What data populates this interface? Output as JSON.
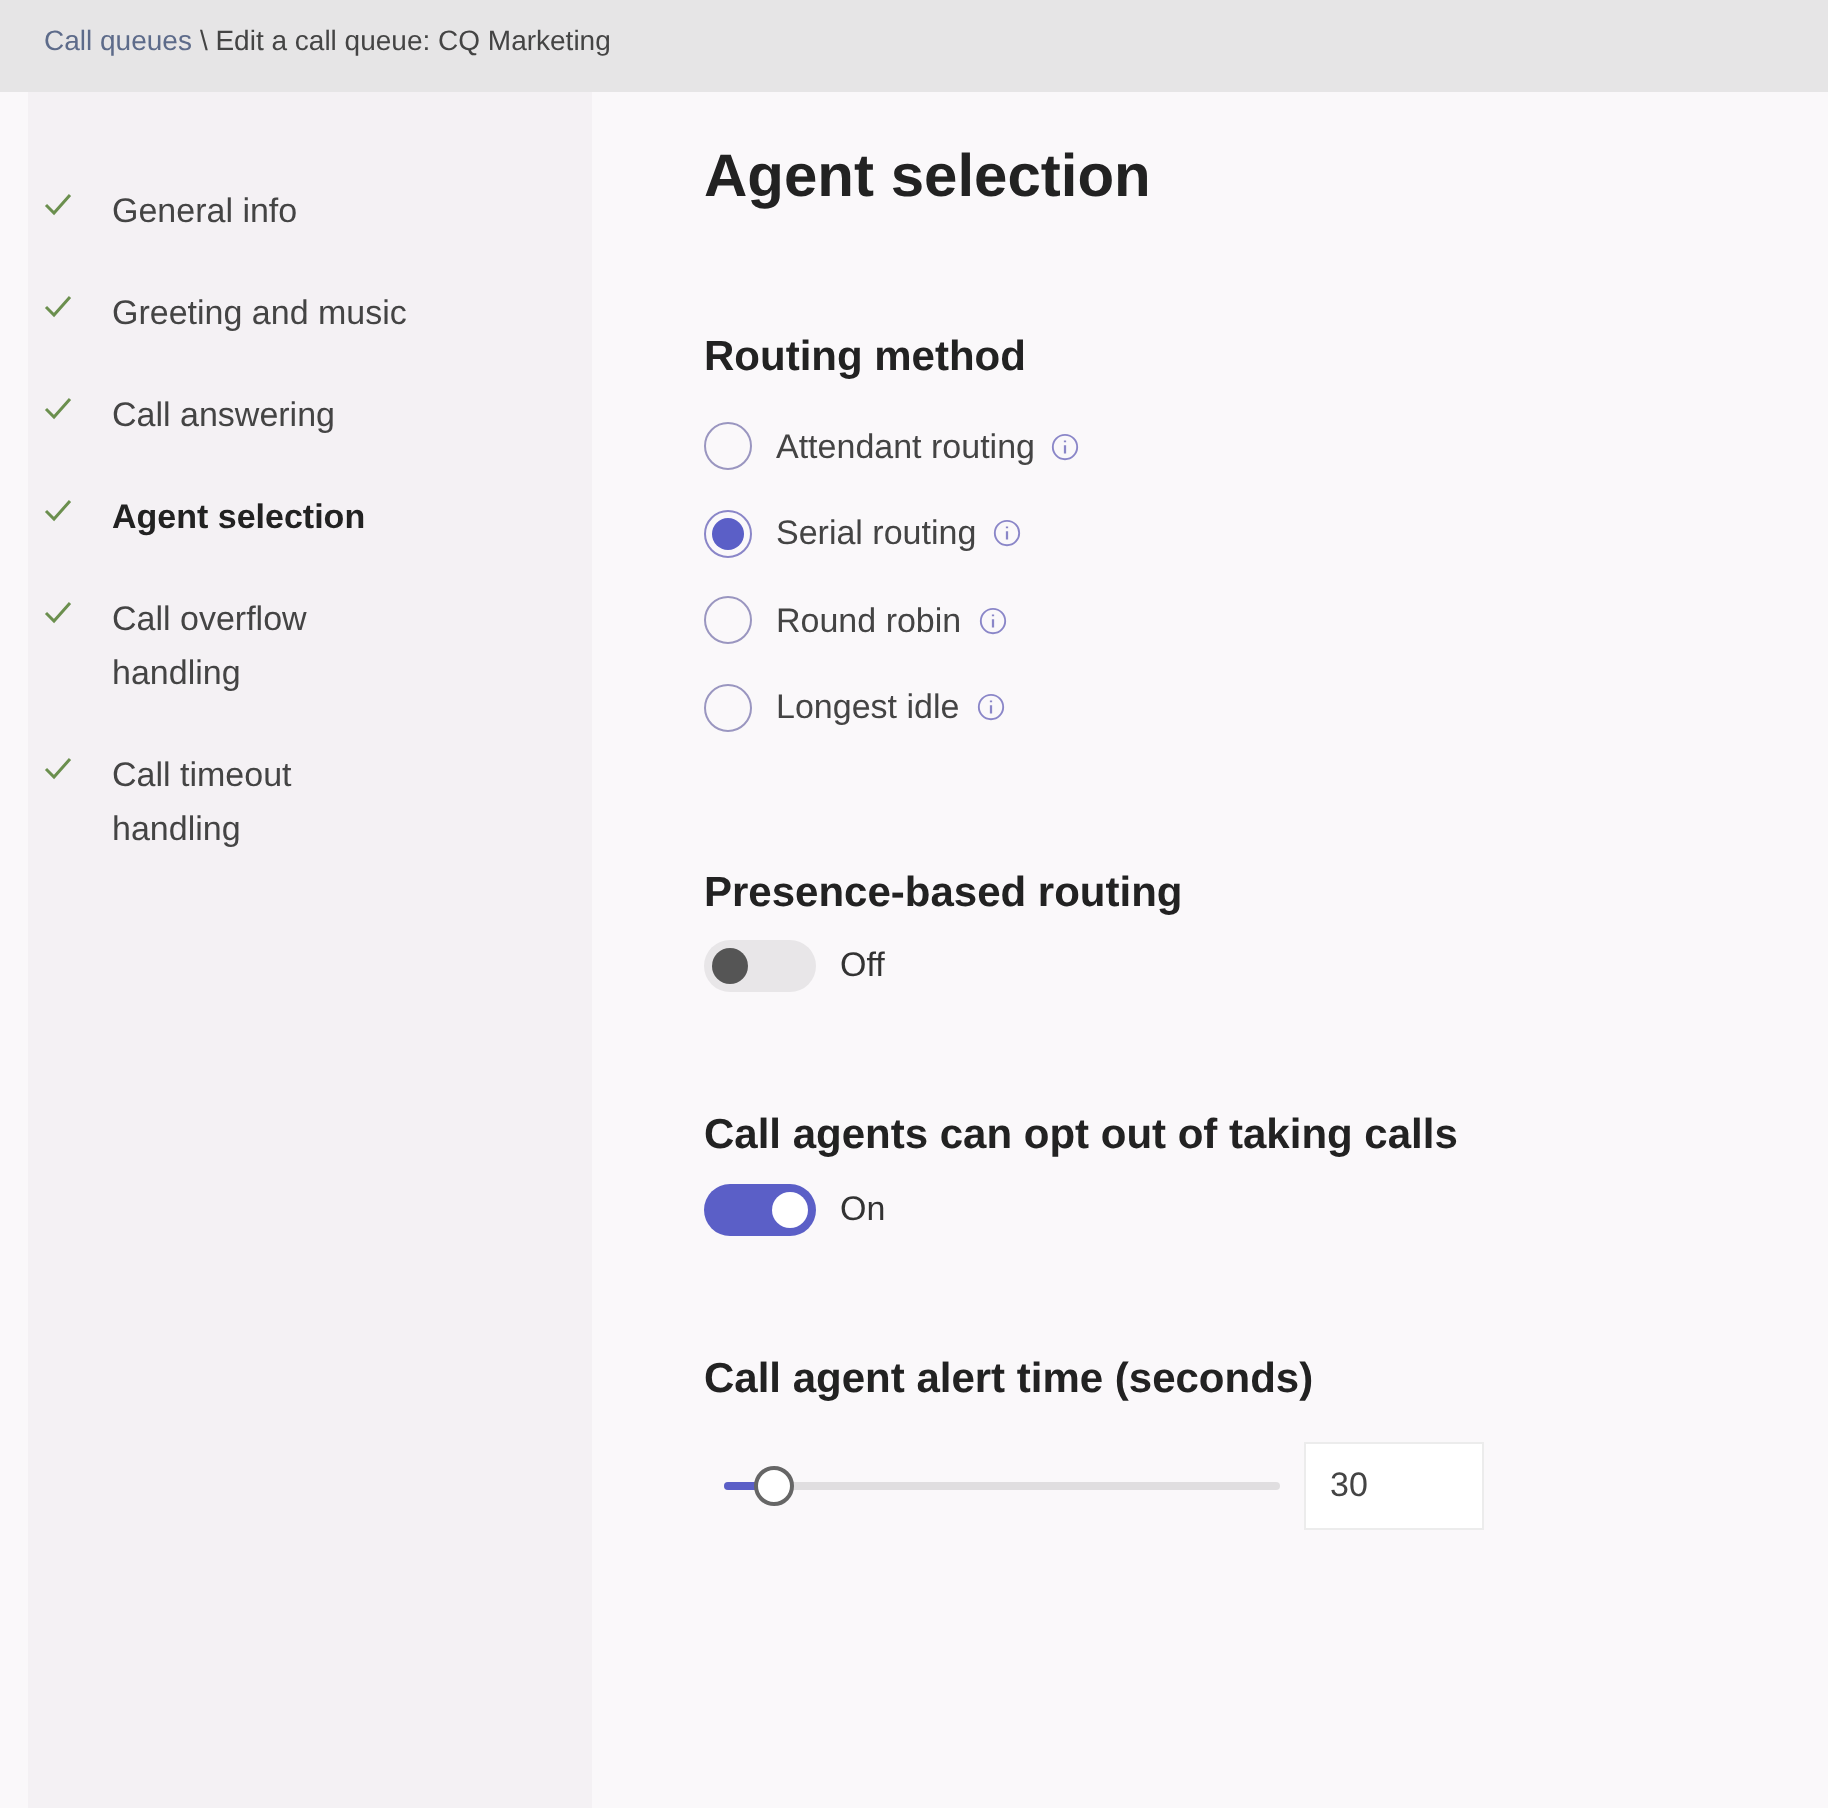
{
  "breadcrumb": {
    "link": "Call queues",
    "current": "\\ Edit a call queue: CQ Marketing"
  },
  "sidebar": {
    "items": [
      {
        "label": "General info",
        "done": true,
        "selected": false
      },
      {
        "label": "Greeting and music",
        "done": true,
        "selected": false
      },
      {
        "label": "Call answering",
        "done": true,
        "selected": false
      },
      {
        "label": "Agent selection",
        "done": true,
        "selected": true
      },
      {
        "label": "Call overflow handling",
        "done": true,
        "selected": false
      },
      {
        "label": "Call timeout handling",
        "done": true,
        "selected": false
      }
    ]
  },
  "title": "Agent selection",
  "routing_method": {
    "heading": "Routing method",
    "options": [
      {
        "label": "Attendant routing",
        "selected": false
      },
      {
        "label": "Serial routing",
        "selected": true
      },
      {
        "label": "Round robin",
        "selected": false
      },
      {
        "label": "Longest idle",
        "selected": false
      }
    ]
  },
  "presence_routing": {
    "heading": "Presence-based routing",
    "on": false,
    "state_label": "Off"
  },
  "opt_out": {
    "heading": "Call agents can opt out of taking calls",
    "on": true,
    "state_label": "On"
  },
  "alert_time": {
    "heading": "Call agent alert time (seconds)",
    "level": 0.09,
    "value": "30"
  }
}
